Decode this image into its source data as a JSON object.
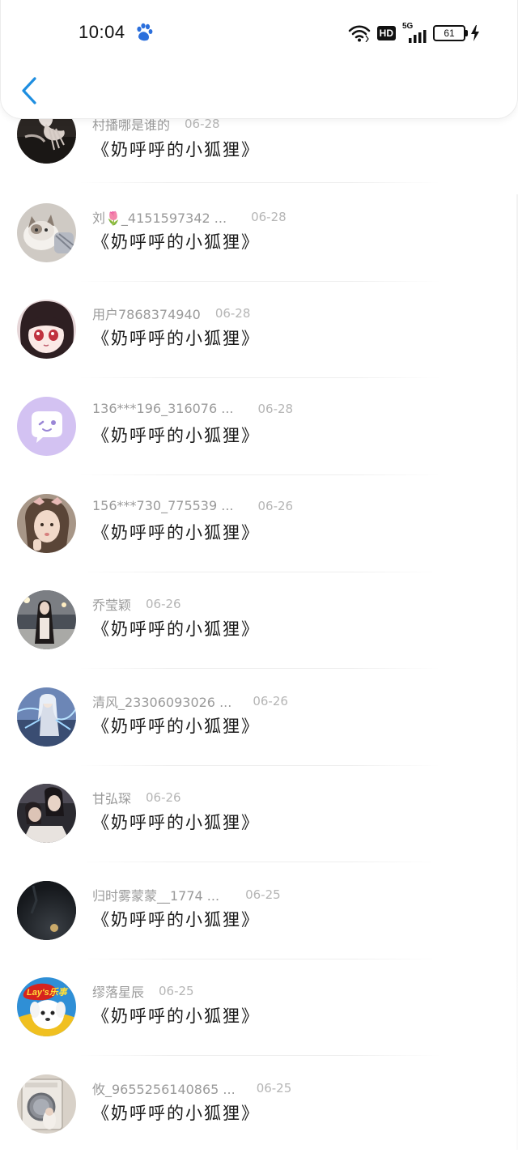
{
  "status_bar": {
    "time": "10:04",
    "hd": "HD",
    "network": "5G",
    "battery": "61"
  },
  "nav": {
    "back_icon": "chevron-left-icon"
  },
  "comments": [
    {
      "user": "村播哪是谁的",
      "date": "06-28",
      "text": "《奶呼呼的小狐狸》",
      "avatar": "photo-hands"
    },
    {
      "user": "刘🌷_4151597342 ...",
      "date": "06-28",
      "text": "《奶呼呼的小狐狸》",
      "avatar": "photo-cat"
    },
    {
      "user": "用户7868374940",
      "date": "06-28",
      "text": "《奶呼呼的小狐狸》",
      "avatar": "photo-anime-girl"
    },
    {
      "user": "136***196_316076 ...",
      "date": "06-28",
      "text": "《奶呼呼的小狐狸》",
      "avatar": "default-chat-avatar"
    },
    {
      "user": "156***730_775539 ...",
      "date": "06-26",
      "text": "《奶呼呼的小狐狸》",
      "avatar": "photo-girl-bow"
    },
    {
      "user": "乔莹颖",
      "date": "06-26",
      "text": "《奶呼呼的小狐狸》",
      "avatar": "photo-girl-night"
    },
    {
      "user": "清风_23306093026 ...",
      "date": "06-26",
      "text": "《奶呼呼的小狐狸》",
      "avatar": "photo-game-character"
    },
    {
      "user": "甘弘琛",
      "date": "06-26",
      "text": "《奶呼呼的小狐狸》",
      "avatar": "photo-couple"
    },
    {
      "user": "归时雾蒙蒙__1774 ...",
      "date": "06-25",
      "text": "《奶呼呼的小狐狸》",
      "avatar": "photo-dark-moon"
    },
    {
      "user": "缪落星辰",
      "date": "06-25",
      "text": "《奶呼呼的小狐狸》",
      "avatar": "photo-lays-dog"
    },
    {
      "user": "攸_9655256140865 ...",
      "date": "06-25",
      "text": "《奶呼呼的小狐狸》",
      "avatar": "photo-washing-machine"
    }
  ],
  "colors": {
    "accent": "#1e8ee0",
    "username": "#9a9a9a",
    "date": "#b5b5b5",
    "comment": "#1a1a1a"
  }
}
